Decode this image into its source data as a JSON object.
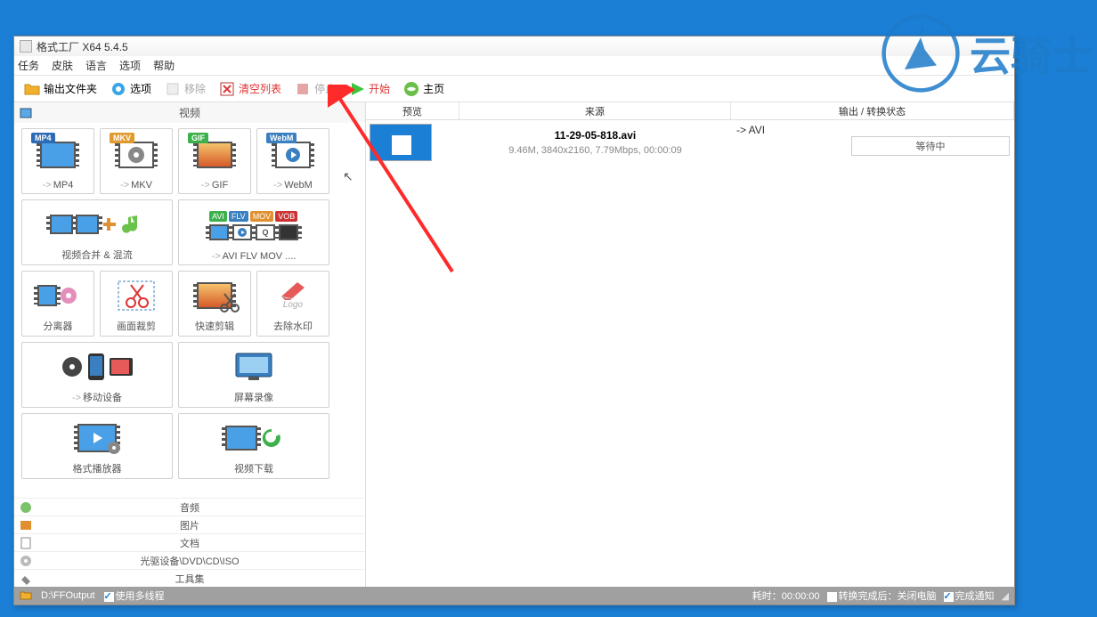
{
  "window": {
    "title": "格式工厂 X64 5.4.5"
  },
  "menu": {
    "items": [
      "任务",
      "皮肤",
      "语言",
      "选项",
      "帮助"
    ]
  },
  "toolbar": {
    "output_folder": "输出文件夹",
    "options": "选项",
    "remove": "移除",
    "clear_list": "清空列表",
    "stop": "停止",
    "start": "开始",
    "home": "主页"
  },
  "sidebar": {
    "active_category": "视频",
    "cards": {
      "mp4": "MP4",
      "mkv": "MKV",
      "gif": "GIF",
      "webm": "WebM",
      "merge": "视频合并 & 混流",
      "avi_more": "AVI FLV MOV ....",
      "splitter": "分离器",
      "crop": "画面裁剪",
      "quickcut": "快速剪辑",
      "watermark": "去除水印",
      "mobile": "移动设备",
      "screenrec": "屏幕录像",
      "player": "格式播放器",
      "download": "视频下载"
    },
    "badges": {
      "mp4": "MP4",
      "mkv": "MKV",
      "gif": "GIF",
      "webm": "WebM",
      "avi": "AVI",
      "flv": "FLV",
      "mov": "MOV",
      "vob": "VOB"
    },
    "categories": {
      "audio": "音频",
      "picture": "图片",
      "document": "文档",
      "optical": "光驱设备\\DVD\\CD\\ISO",
      "toolkit": "工具集"
    }
  },
  "task_headers": {
    "preview": "预览",
    "source": "来源",
    "status": "输出 / 转换状态"
  },
  "task": {
    "filename": "11-29-05-818.avi",
    "meta": "9.46M, 3840x2160, 7.79Mbps, 00:00:09",
    "dest": "-> AVI",
    "status": "等待中"
  },
  "statusbar": {
    "output_path": "D:\\FFOutput",
    "multithread": "使用多线程",
    "elapsed_label": "耗时：",
    "elapsed_value": "00:00:00",
    "after_done": "转换完成后：",
    "after_done_opt": "关闭电脑",
    "notify": "完成通知"
  },
  "watermark_text": "云骑士"
}
